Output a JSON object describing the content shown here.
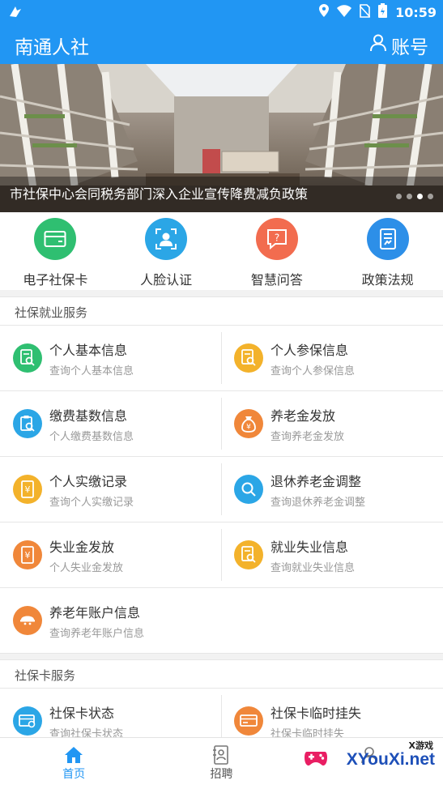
{
  "status_bar": {
    "time": "10:59",
    "icons": [
      "notification-app-icon",
      "location-icon",
      "wifi-icon",
      "no-sim-icon",
      "battery-icon"
    ]
  },
  "app_bar": {
    "title": "南通人社",
    "account_label": "账号",
    "account_icon": "user-icon"
  },
  "banner": {
    "caption": "市社保中心会同税务部门深入企业宣传降费减负政策",
    "slide_count": 4,
    "active_slide": 3
  },
  "quick_actions": [
    {
      "label": "电子社保卡",
      "icon": "card-icon",
      "color": "#2fbf71"
    },
    {
      "label": "人脸认证",
      "icon": "face-scan-icon",
      "color": "#2ba6e6"
    },
    {
      "label": "智慧问答",
      "icon": "chat-question-icon",
      "color": "#f26c4f"
    },
    {
      "label": "政策法规",
      "icon": "document-icon",
      "color": "#2d8fe8"
    }
  ],
  "section_employment": {
    "title": "社保就业服务",
    "items": [
      {
        "title": "个人基本信息",
        "subtitle": "查询个人基本信息",
        "icon": "document-search-icon",
        "color": "#2fbf71"
      },
      {
        "title": "个人参保信息",
        "subtitle": "查询个人参保信息",
        "icon": "document-search-icon",
        "color": "#f3b22b"
      },
      {
        "title": "缴费基数信息",
        "subtitle": "个人缴费基数信息",
        "icon": "clipboard-search-icon",
        "color": "#2ba6e6"
      },
      {
        "title": "养老金发放",
        "subtitle": "查询养老金发放",
        "icon": "money-bag-icon",
        "color": "#f0873a"
      },
      {
        "title": "个人实缴记录",
        "subtitle": "查询个人实缴记录",
        "icon": "yuan-document-icon",
        "color": "#f3b22b"
      },
      {
        "title": "退休养老金调整",
        "subtitle": "查询退休养老金调整",
        "icon": "search-icon",
        "color": "#2ba6e6"
      },
      {
        "title": "失业金发放",
        "subtitle": "个人失业金发放",
        "icon": "yuan-document-icon",
        "color": "#f0873a"
      },
      {
        "title": "就业失业信息",
        "subtitle": "查询就业失业信息",
        "icon": "document-search-icon",
        "color": "#f3b22b"
      },
      {
        "title": "养老年账户信息",
        "subtitle": "查询养老年账户信息",
        "icon": "elder-face-icon",
        "color": "#f0873a"
      }
    ]
  },
  "section_card": {
    "title": "社保卡服务",
    "items": [
      {
        "title": "社保卡状态",
        "subtitle": "查询社保卡状态",
        "icon": "card-status-icon",
        "color": "#2ba6e6"
      },
      {
        "title": "社保卡临时挂失",
        "subtitle": "社保卡临时挂失",
        "icon": "card-lost-icon",
        "color": "#f0873a"
      }
    ]
  },
  "tab_bar": {
    "tabs": [
      {
        "label": "首页",
        "icon": "home-icon",
        "active": true
      },
      {
        "label": "招聘",
        "icon": "resume-icon",
        "active": false
      },
      {
        "label": "",
        "icon": "profile-icon",
        "active": false
      }
    ]
  },
  "watermark": {
    "top_text": "X游戏",
    "text": "XYouXi.net"
  }
}
